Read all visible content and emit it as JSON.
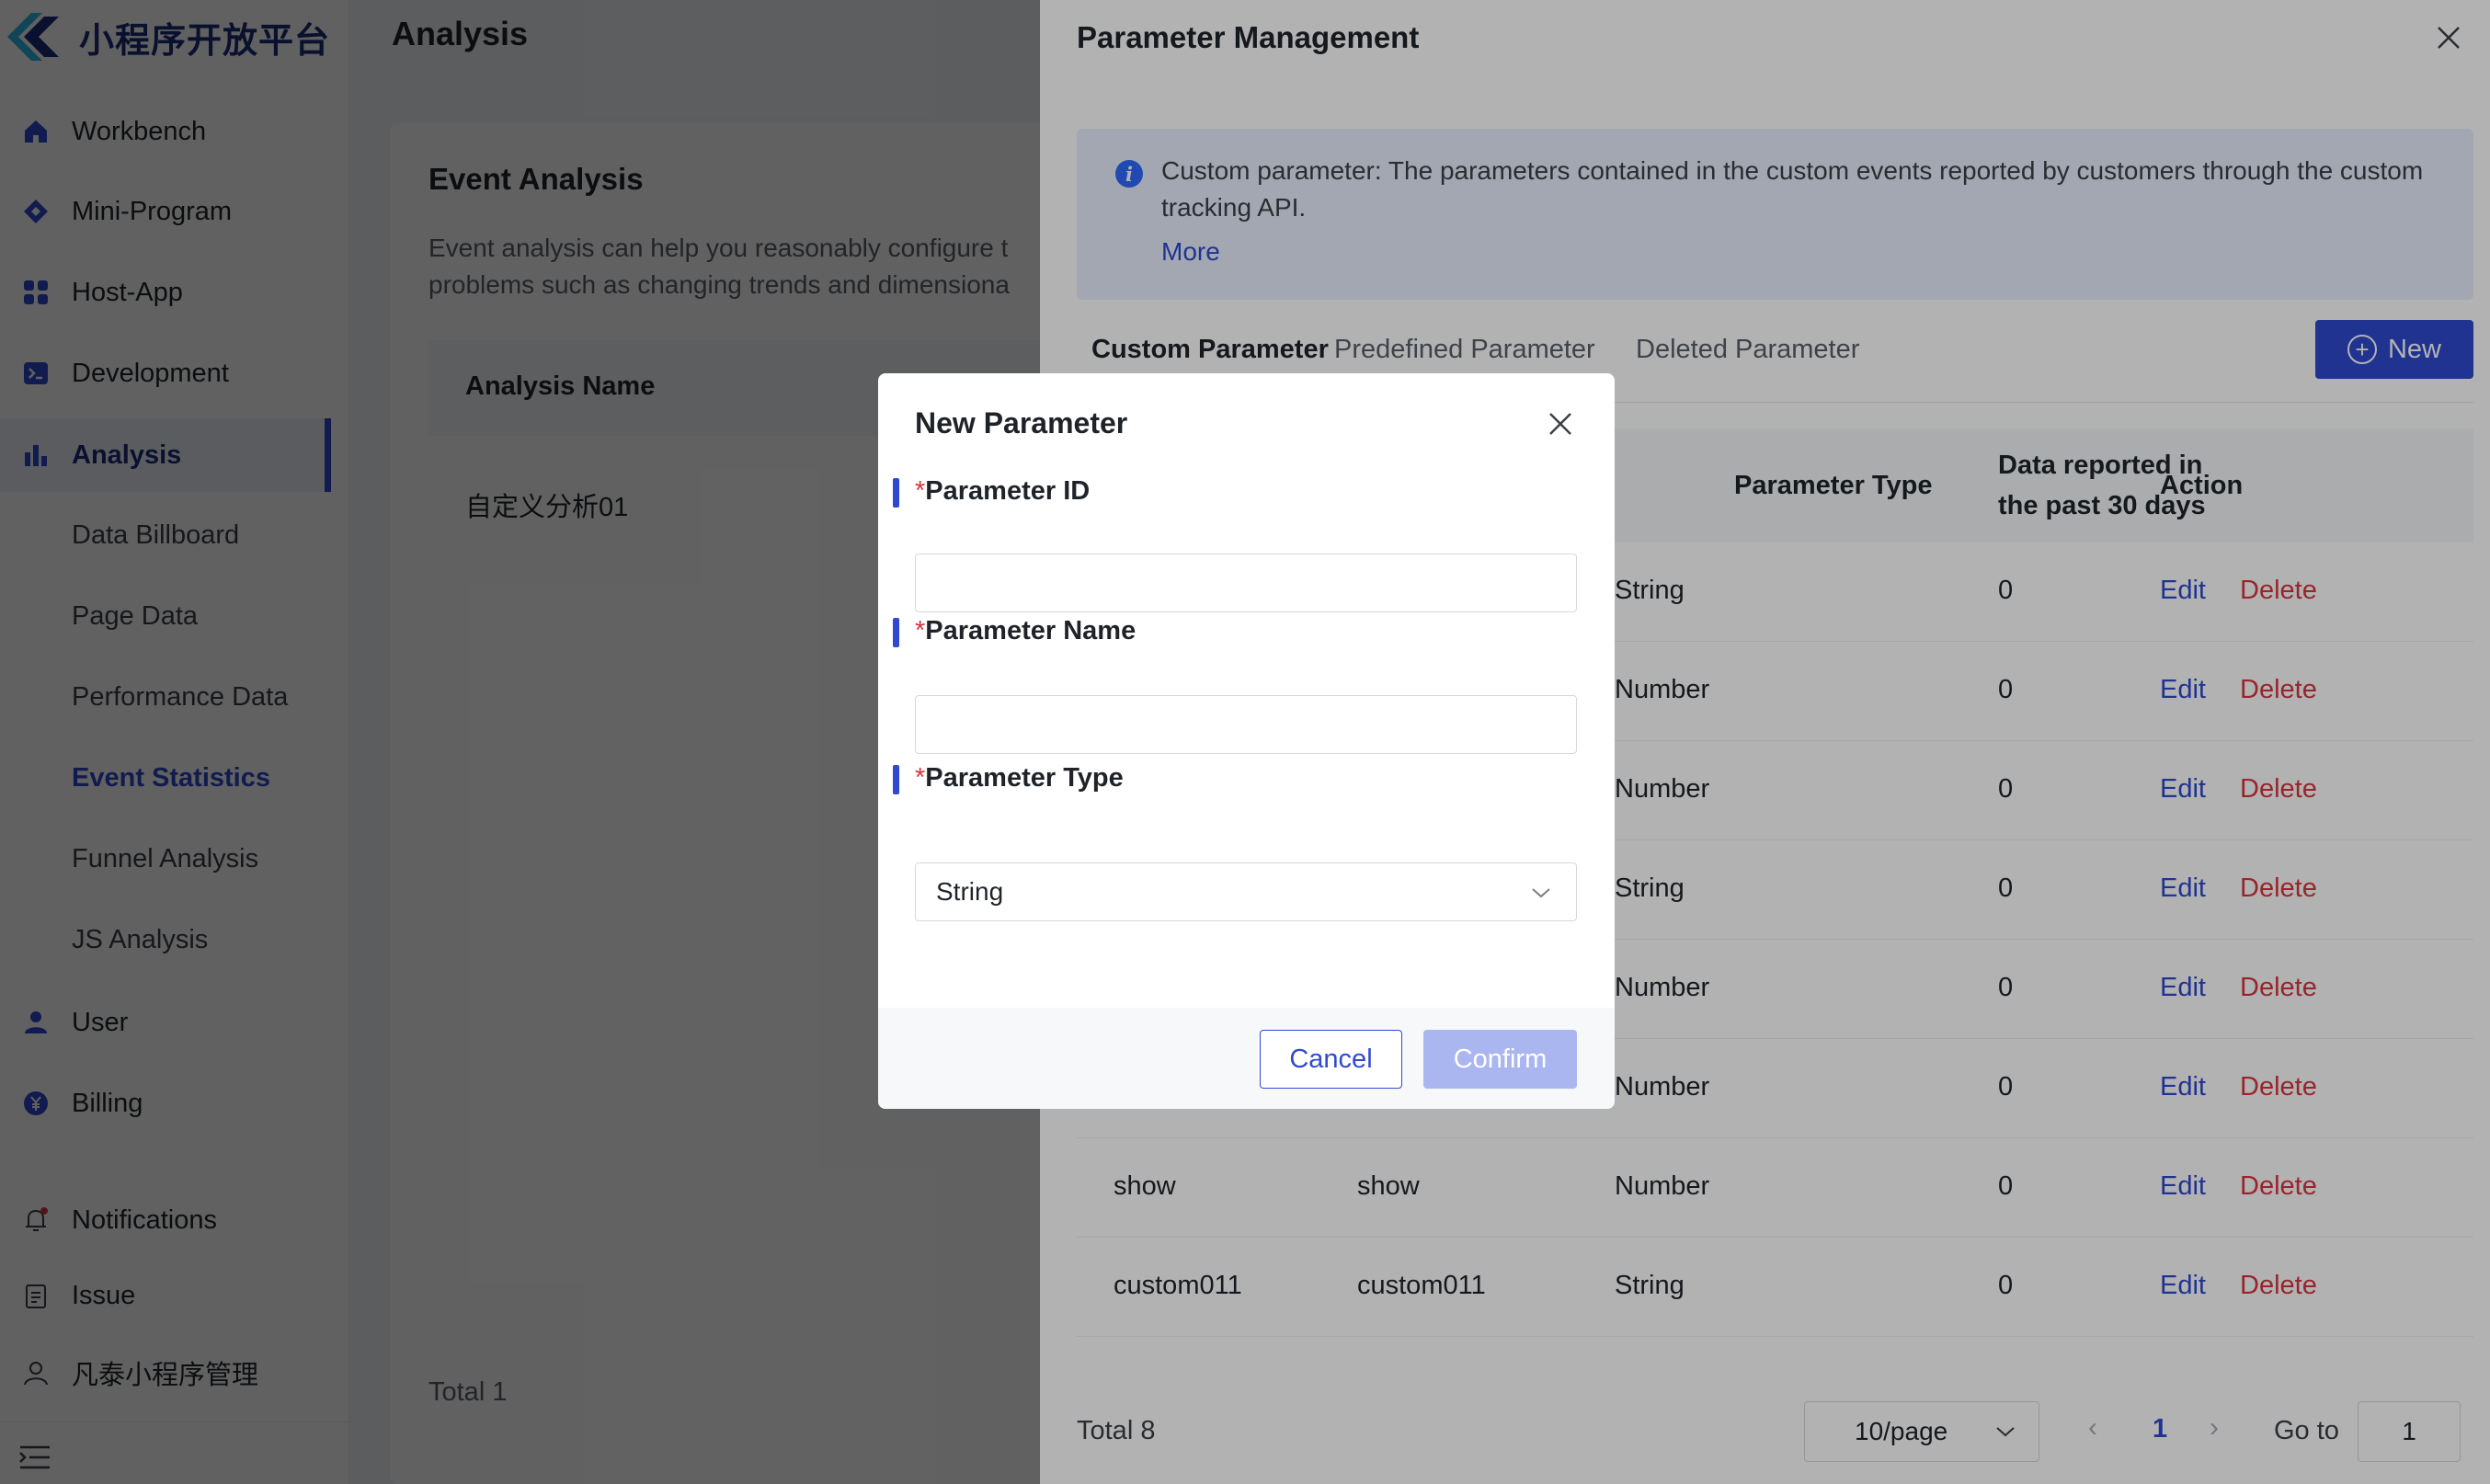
{
  "brand": {
    "name": "小程序开放平台"
  },
  "sidebar": {
    "items": [
      {
        "label": "Workbench",
        "icon": "home-icon"
      },
      {
        "label": "Mini-Program",
        "icon": "diamond-icon"
      },
      {
        "label": "Host-App",
        "icon": "grid-icon"
      },
      {
        "label": "Development",
        "icon": "terminal-icon"
      },
      {
        "label": "Analysis",
        "icon": "bar-chart-icon",
        "active": true
      }
    ],
    "analysis_sub": [
      {
        "label": "Data Billboard"
      },
      {
        "label": "Page Data"
      },
      {
        "label": "Performance Data"
      },
      {
        "label": "Event Statistics",
        "current": true
      },
      {
        "label": "Funnel Analysis"
      },
      {
        "label": "JS Analysis"
      }
    ],
    "more_items": [
      {
        "label": "User",
        "icon": "user-icon"
      },
      {
        "label": "Billing",
        "icon": "yen-icon"
      }
    ],
    "bottom": [
      {
        "label": "Notifications",
        "icon": "bell-icon"
      },
      {
        "label": "Issue",
        "icon": "clipboard-icon"
      },
      {
        "label": "凡泰小程序管理",
        "icon": "person-icon"
      }
    ]
  },
  "page": {
    "title": "Analysis",
    "card_title": "Event Analysis",
    "card_desc_1": "Event analysis can help you reasonably configure t",
    "card_desc_2": "problems such as changing trends and dimensiona",
    "column": "Analysis Name",
    "row": "自定义分析01",
    "total": "Total 1"
  },
  "drawer": {
    "title": "Parameter Management",
    "info_text": "Custom parameter: The parameters contained in the custom events reported by customers through the custom tracking API.",
    "info_more": "More",
    "tabs": [
      "Custom Parameter",
      "Predefined Parameter",
      "Deleted Parameter"
    ],
    "new_button": "New",
    "columns": {
      "type": "Parameter Type",
      "reported_1": "Data reported in",
      "reported_2": "the past 30 days",
      "action": "Action"
    },
    "rows": [
      {
        "id": "",
        "name": "",
        "type": "String",
        "reported": "0"
      },
      {
        "id": "",
        "name": "",
        "type": "Number",
        "reported": "0"
      },
      {
        "id": "",
        "name": "",
        "type": "Number",
        "reported": "0"
      },
      {
        "id": "",
        "name": "",
        "type": "String",
        "reported": "0"
      },
      {
        "id": "",
        "name": "",
        "type": "Number",
        "reported": "0"
      },
      {
        "id": "",
        "name": "",
        "type": "Number",
        "reported": "0"
      },
      {
        "id": "show",
        "name": "show",
        "type": "Number",
        "reported": "0"
      },
      {
        "id": "custom011",
        "name": "custom011",
        "type": "String",
        "reported": "0"
      }
    ],
    "edit_label": "Edit",
    "delete_label": "Delete",
    "total": "Total 8",
    "page_size": "10/page",
    "current_page": "1",
    "goto_label": "Go to",
    "goto_value": "1"
  },
  "modal": {
    "title": "New Parameter",
    "required_mark": "*",
    "id_label": "Parameter ID",
    "id_value": "",
    "name_label": "Parameter Name",
    "name_value": "",
    "type_label": "Parameter Type",
    "type_value": "String",
    "cancel": "Cancel",
    "confirm": "Confirm"
  },
  "colors": {
    "primary": "#2f4ad0",
    "danger": "#d9363e",
    "confirm_disabled": "#aab6f0",
    "info_bg": "#e9efff"
  }
}
